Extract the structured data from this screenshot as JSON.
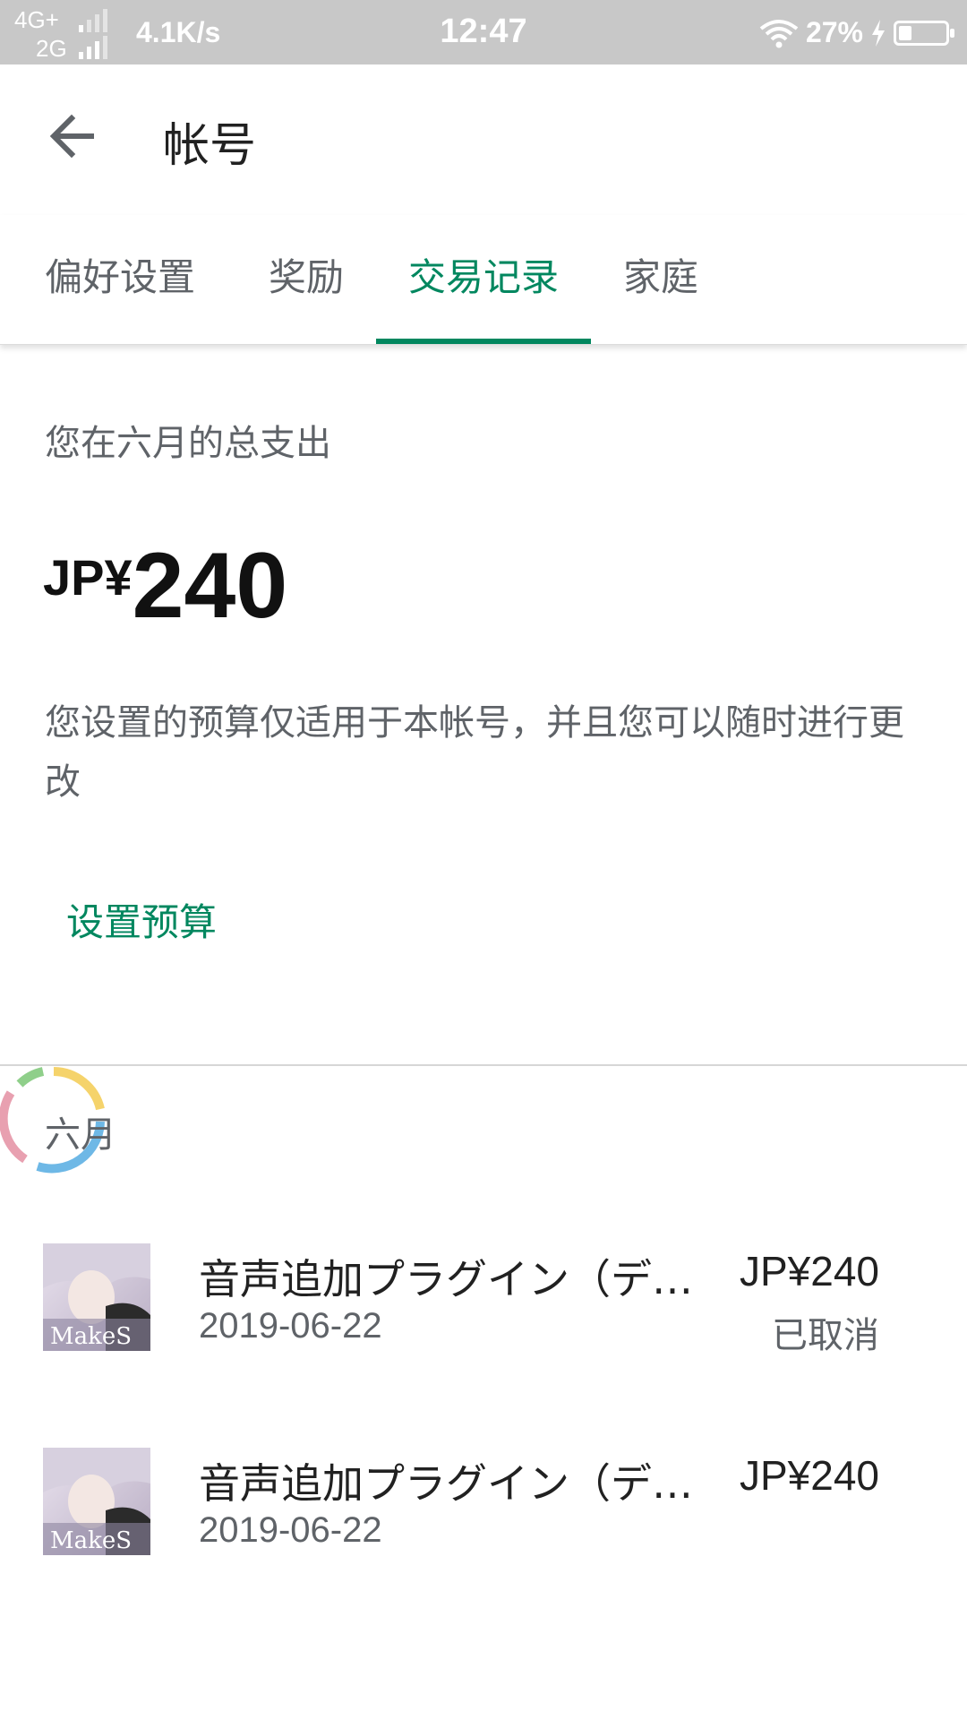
{
  "status_bar": {
    "network_top": "4G+",
    "network_bottom": "2G",
    "speed": "4.1K/s",
    "time": "12:47",
    "battery_percent": "27%",
    "battery_level": 0.27,
    "icons": [
      "signal-icon",
      "wifi-icon",
      "charging-icon",
      "battery-icon"
    ]
  },
  "header": {
    "title": "帐号",
    "back_icon": "arrow-left-icon"
  },
  "tabs": [
    {
      "label": "偏好设置"
    },
    {
      "label": "奖励"
    },
    {
      "label": "交易记录",
      "active": true
    },
    {
      "label": "家庭"
    }
  ],
  "accent_color": "#01875f",
  "spend": {
    "label": "您在六月的总支出",
    "currency": "JP¥",
    "amount": "240",
    "note": "您设置的预算仅适用于本帐号，并且您可以随时进行更改",
    "set_budget": "设置预算"
  },
  "month": {
    "label": "六月"
  },
  "transactions": [
    {
      "title": "音声追加プラグイン（デ…",
      "date": "2019-06-22",
      "price": "JP¥240",
      "status": "已取消",
      "thumb_text": "MakeS"
    },
    {
      "title": "音声追加プラグイン（デ…",
      "date": "2019-06-22",
      "price": "JP¥240",
      "status": "",
      "thumb_text": "MakeS"
    }
  ]
}
